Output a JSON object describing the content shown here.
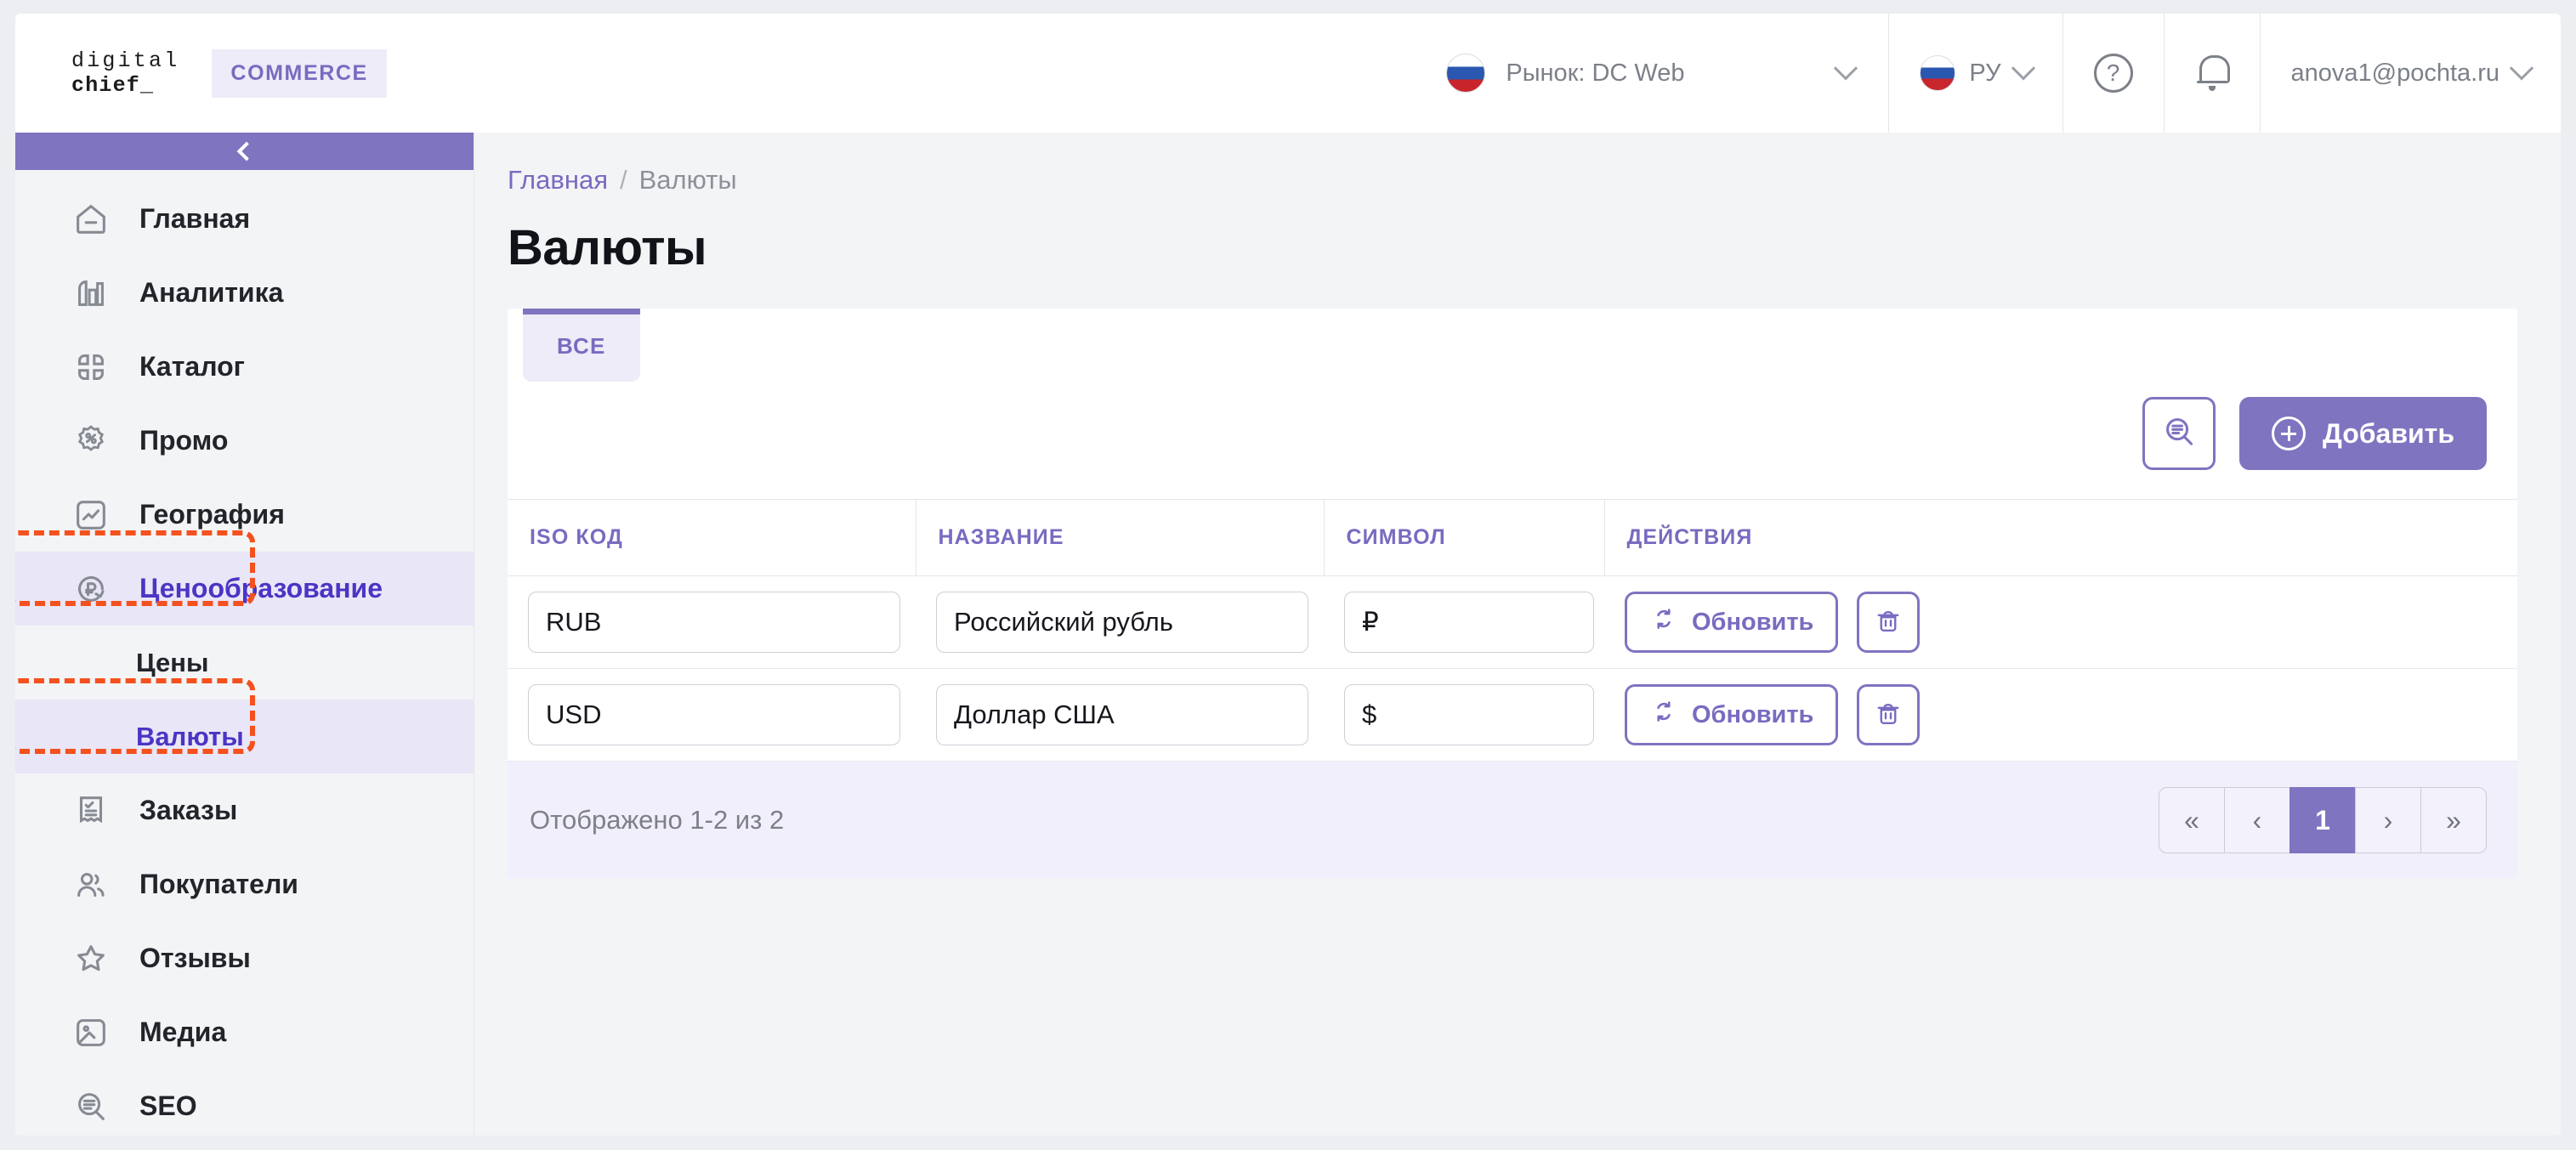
{
  "header": {
    "logo_line1": "digital",
    "logo_line2": "chief_",
    "commerce_badge": "COMMERCE",
    "market_label": "Рынок: DC Web",
    "language_label": "РУ",
    "help_icon": "question-mark-circle-icon",
    "bell_icon": "notification-bell-icon",
    "user_email": "anova1@pochta.ru"
  },
  "sidebar": {
    "collapse_icon": "chevron-left-icon",
    "items": [
      {
        "label": "Главная",
        "icon": "home-icon",
        "active": false,
        "sub": false
      },
      {
        "label": "Аналитика",
        "icon": "analytics-bar-chart-icon",
        "active": false,
        "sub": false
      },
      {
        "label": "Каталог",
        "icon": "catalog-grid-icon",
        "active": false,
        "sub": false
      },
      {
        "label": "Промо",
        "icon": "promo-percent-badge-icon",
        "active": false,
        "sub": false
      },
      {
        "label": "География",
        "icon": "geography-chart-icon",
        "active": false,
        "sub": false
      },
      {
        "label": "Ценообразование",
        "icon": "pricing-ruble-refresh-icon",
        "active": true,
        "sub": false
      },
      {
        "label": "Цены",
        "icon": "",
        "active": false,
        "sub": true
      },
      {
        "label": "Валюты",
        "icon": "",
        "active": true,
        "sub": true
      },
      {
        "label": "Заказы",
        "icon": "orders-receipt-icon",
        "active": false,
        "sub": false
      },
      {
        "label": "Покупатели",
        "icon": "customers-people-icon",
        "active": false,
        "sub": false
      },
      {
        "label": "Отзывы",
        "icon": "reviews-star-icon",
        "active": false,
        "sub": false
      },
      {
        "label": "Медиа",
        "icon": "media-image-icon",
        "active": false,
        "sub": false
      },
      {
        "label": "SEO",
        "icon": "seo-search-doc-icon",
        "active": false,
        "sub": false
      }
    ]
  },
  "breadcrumb": {
    "home": "Главная",
    "separator": "/",
    "current": "Валюты"
  },
  "page": {
    "title": "Валюты"
  },
  "tabs": [
    {
      "label": "ВСЕ",
      "active": true
    }
  ],
  "toolbar": {
    "filter_icon": "search-list-filter-icon",
    "add_label": "Добавить",
    "add_icon": "plus-circle-icon"
  },
  "table": {
    "columns": [
      "ISO КОД",
      "НАЗВАНИЕ",
      "СИМВОЛ",
      "ДЕЙСТВИЯ"
    ],
    "rows": [
      {
        "iso": "RUB",
        "name": "Российский рубль",
        "symbol": "₽",
        "refresh_label": "Обновить",
        "refresh_icon": "refresh-arrows-icon",
        "delete_icon": "trash-bin-icon"
      },
      {
        "iso": "USD",
        "name": "Доллар США",
        "symbol": "$",
        "refresh_label": "Обновить",
        "refresh_icon": "refresh-arrows-icon",
        "delete_icon": "trash-bin-icon"
      }
    ]
  },
  "footer": {
    "summary": "Отображено 1-2 из 2",
    "pagination": {
      "first": "«",
      "prev": "‹",
      "current_page": "1",
      "next": "›",
      "last": "»"
    }
  },
  "colors": {
    "accent_purple": "#7f74c0",
    "link_purple": "#7a6ac0",
    "active_text": "#4c34c4",
    "active_bg": "#e9e6f7",
    "annotation_orange": "#f4511e",
    "footer_bg": "#f1effb",
    "page_bg": "#f3f4f6"
  }
}
